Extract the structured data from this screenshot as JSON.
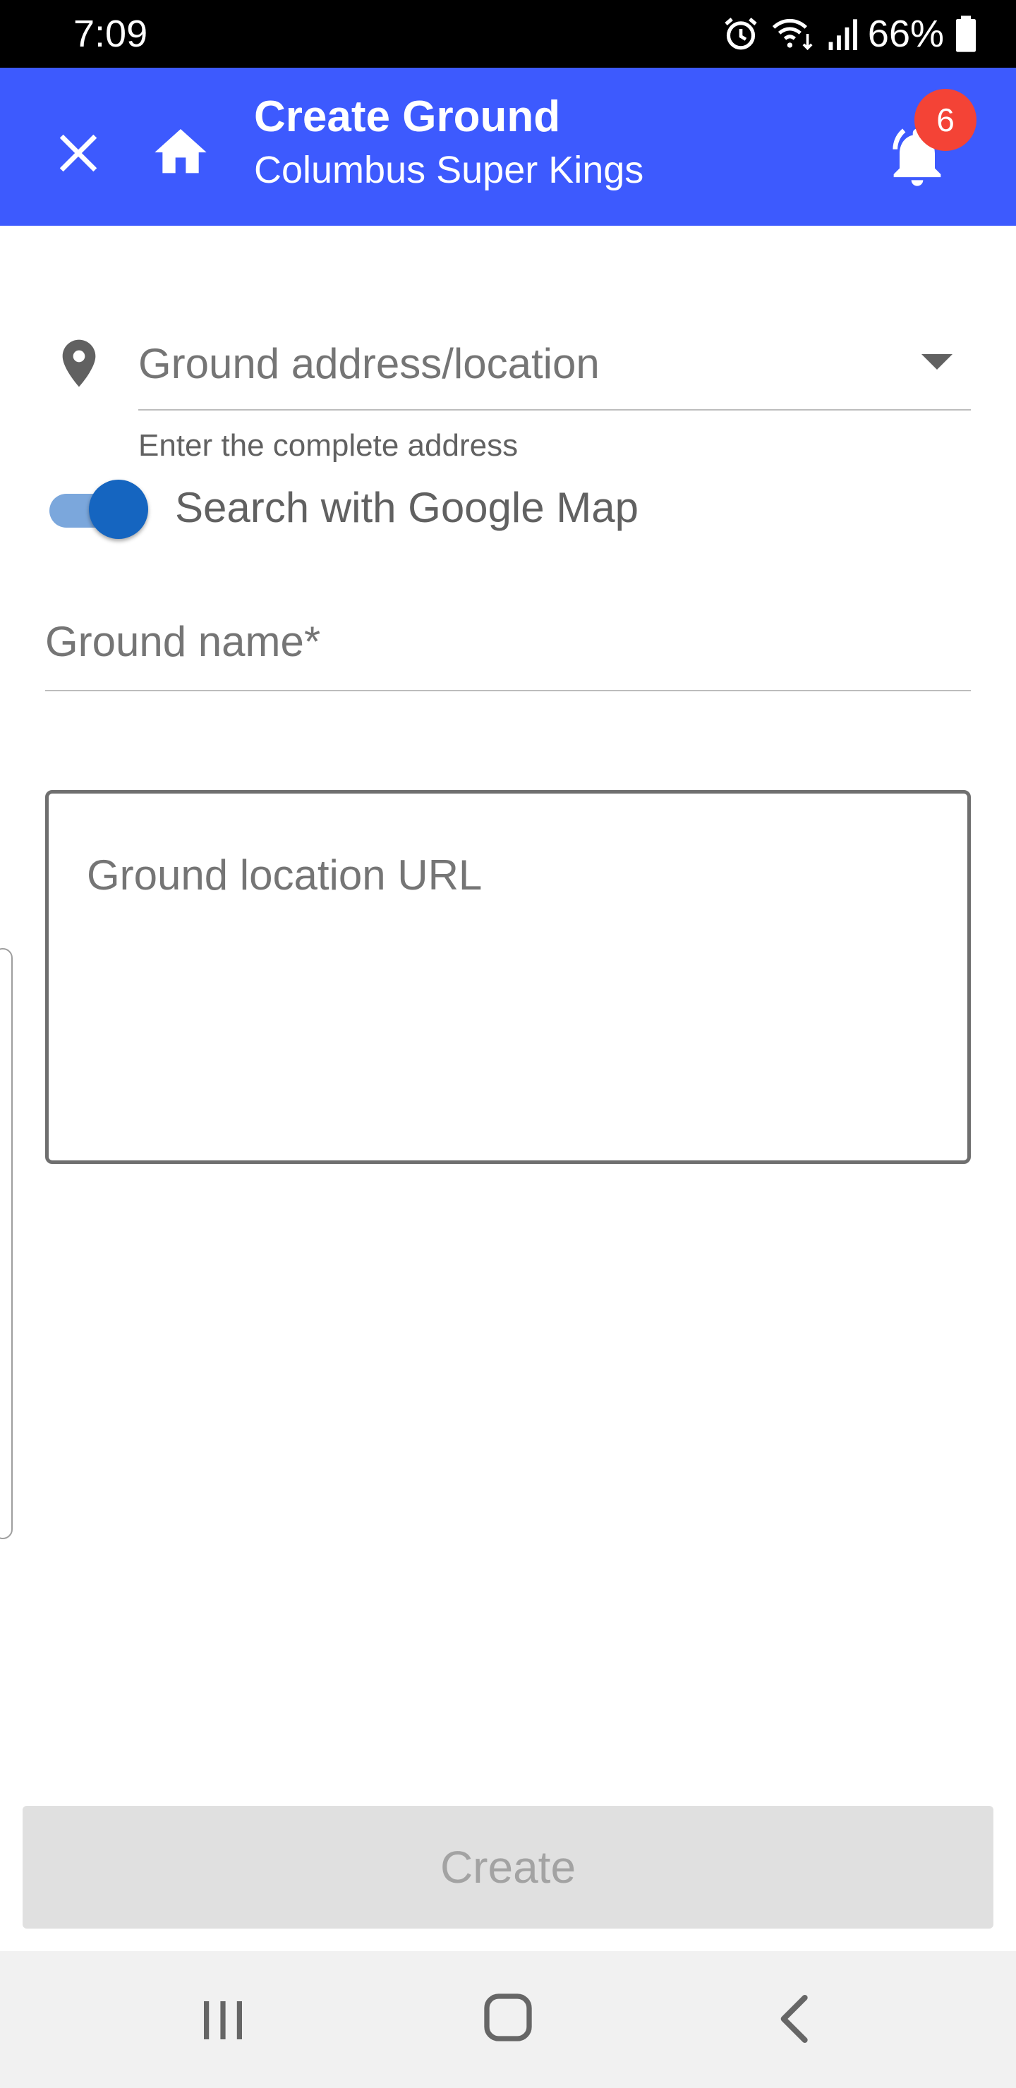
{
  "status_bar": {
    "time": "7:09",
    "battery": "66%",
    "icons": [
      "alarm-icon",
      "wifi-icon",
      "signal-icon",
      "battery-icon"
    ]
  },
  "app_bar": {
    "title": "Create Ground",
    "subtitle": "Columbus Super Kings",
    "notification_count": "6",
    "color": "#3d5afe"
  },
  "form": {
    "address_placeholder": "Ground address/location",
    "address_helper": "Enter the complete address",
    "google_map_toggle_label": "Search with Google Map",
    "google_map_toggle_on": true,
    "ground_name_placeholder": "Ground name*",
    "location_url_placeholder": "Ground location URL"
  },
  "actions": {
    "create_label": "Create"
  },
  "colors": {
    "accent": "#1565c0",
    "badge": "#f44336",
    "disabled_button": "#e0e0e0"
  }
}
